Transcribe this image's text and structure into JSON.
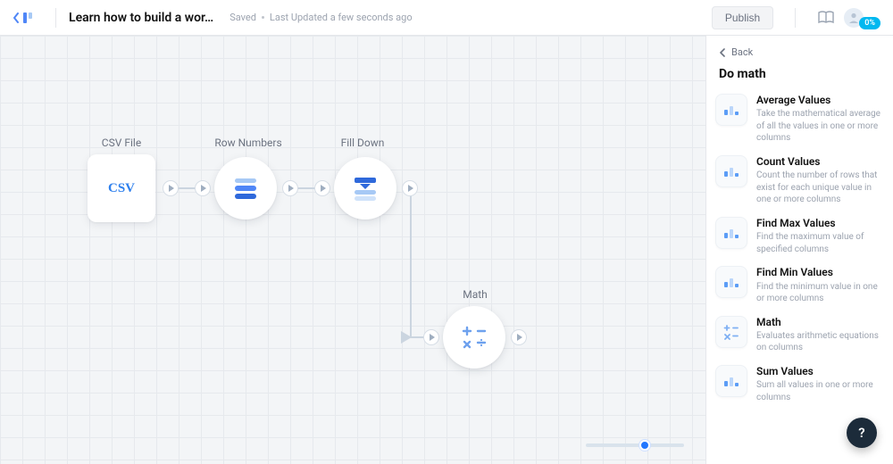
{
  "header": {
    "title": "Learn how to build a wor…",
    "saved_label": "Saved",
    "updated_label": "Last Updated a few seconds ago",
    "publish_label": "Publish",
    "progress_badge": "0%"
  },
  "canvas": {
    "nodes": {
      "csv": {
        "label": "CSV File",
        "glyph": "CSV"
      },
      "rownum": {
        "label": "Row Numbers"
      },
      "filldown": {
        "label": "Fill Down"
      },
      "math": {
        "label": "Math"
      }
    },
    "zoom_percent": 60
  },
  "panel": {
    "back_label": "Back",
    "title": "Do math",
    "items": [
      {
        "icon": "bars",
        "title": "Average Values",
        "desc": "Take the mathematical average of all the values in one or more columns"
      },
      {
        "icon": "bars",
        "title": "Count Values",
        "desc": "Count the number of rows that exist for each unique value in one or more columns"
      },
      {
        "icon": "bars",
        "title": "Find Max Values",
        "desc": "Find the maximum value of specified columns"
      },
      {
        "icon": "bars",
        "title": "Find Min Values",
        "desc": "Find the minimum value in one or more columns"
      },
      {
        "icon": "math",
        "title": "Math",
        "desc": "Evaluates arithmetic equations on columns"
      },
      {
        "icon": "bars",
        "title": "Sum Values",
        "desc": "Sum all values in one or more columns"
      }
    ]
  },
  "help_glyph": "?"
}
